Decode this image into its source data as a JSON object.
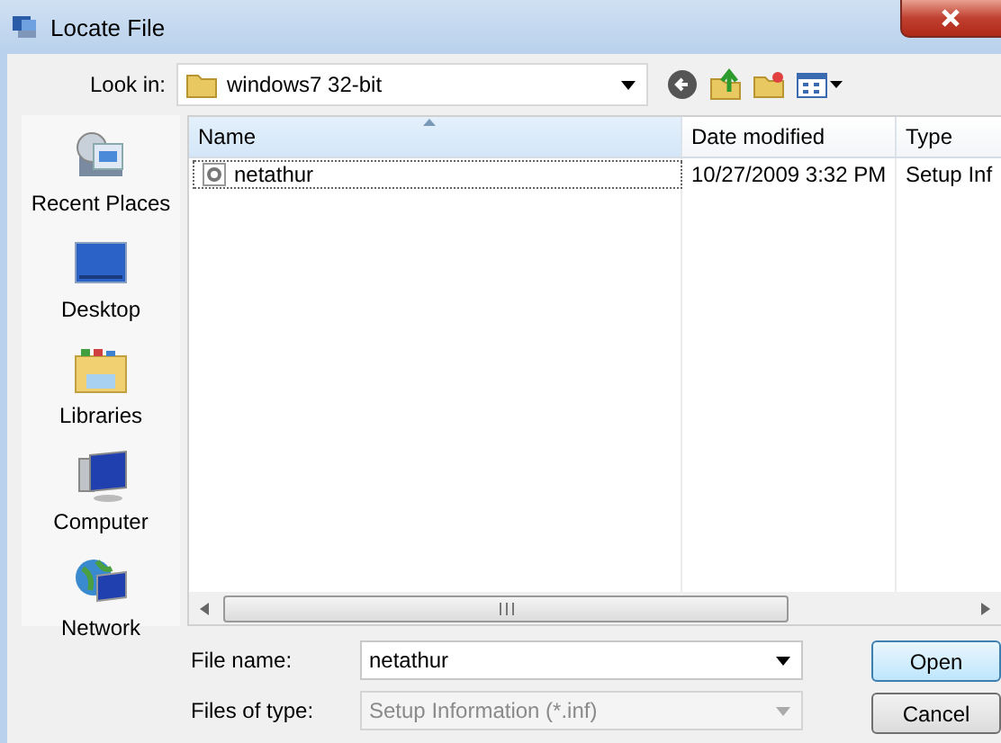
{
  "window": {
    "title": "Locate File"
  },
  "look_in": {
    "label": "Look in:",
    "value": "windows7 32-bit"
  },
  "places": [
    {
      "label": "Recent Places",
      "kind": "recent"
    },
    {
      "label": "Desktop",
      "kind": "desktop"
    },
    {
      "label": "Libraries",
      "kind": "libraries"
    },
    {
      "label": "Computer",
      "kind": "computer"
    },
    {
      "label": "Network",
      "kind": "network"
    }
  ],
  "table": {
    "columns": [
      {
        "label": "Name",
        "sorted": true
      },
      {
        "label": "Date modified",
        "sorted": false
      },
      {
        "label": "Type",
        "sorted": false
      }
    ],
    "rows": [
      {
        "name": "netathur",
        "date": "10/27/2009 3:32 PM",
        "type": "Setup Inf",
        "focused": true
      }
    ]
  },
  "file_name": {
    "label": "File name:",
    "value": "netathur",
    "disabled": false
  },
  "file_type": {
    "label": "Files of type:",
    "value": "Setup Information (*.inf)",
    "disabled": true
  },
  "buttons": [
    {
      "label": "Open",
      "default": true
    },
    {
      "label": "Cancel",
      "default": false
    }
  ]
}
